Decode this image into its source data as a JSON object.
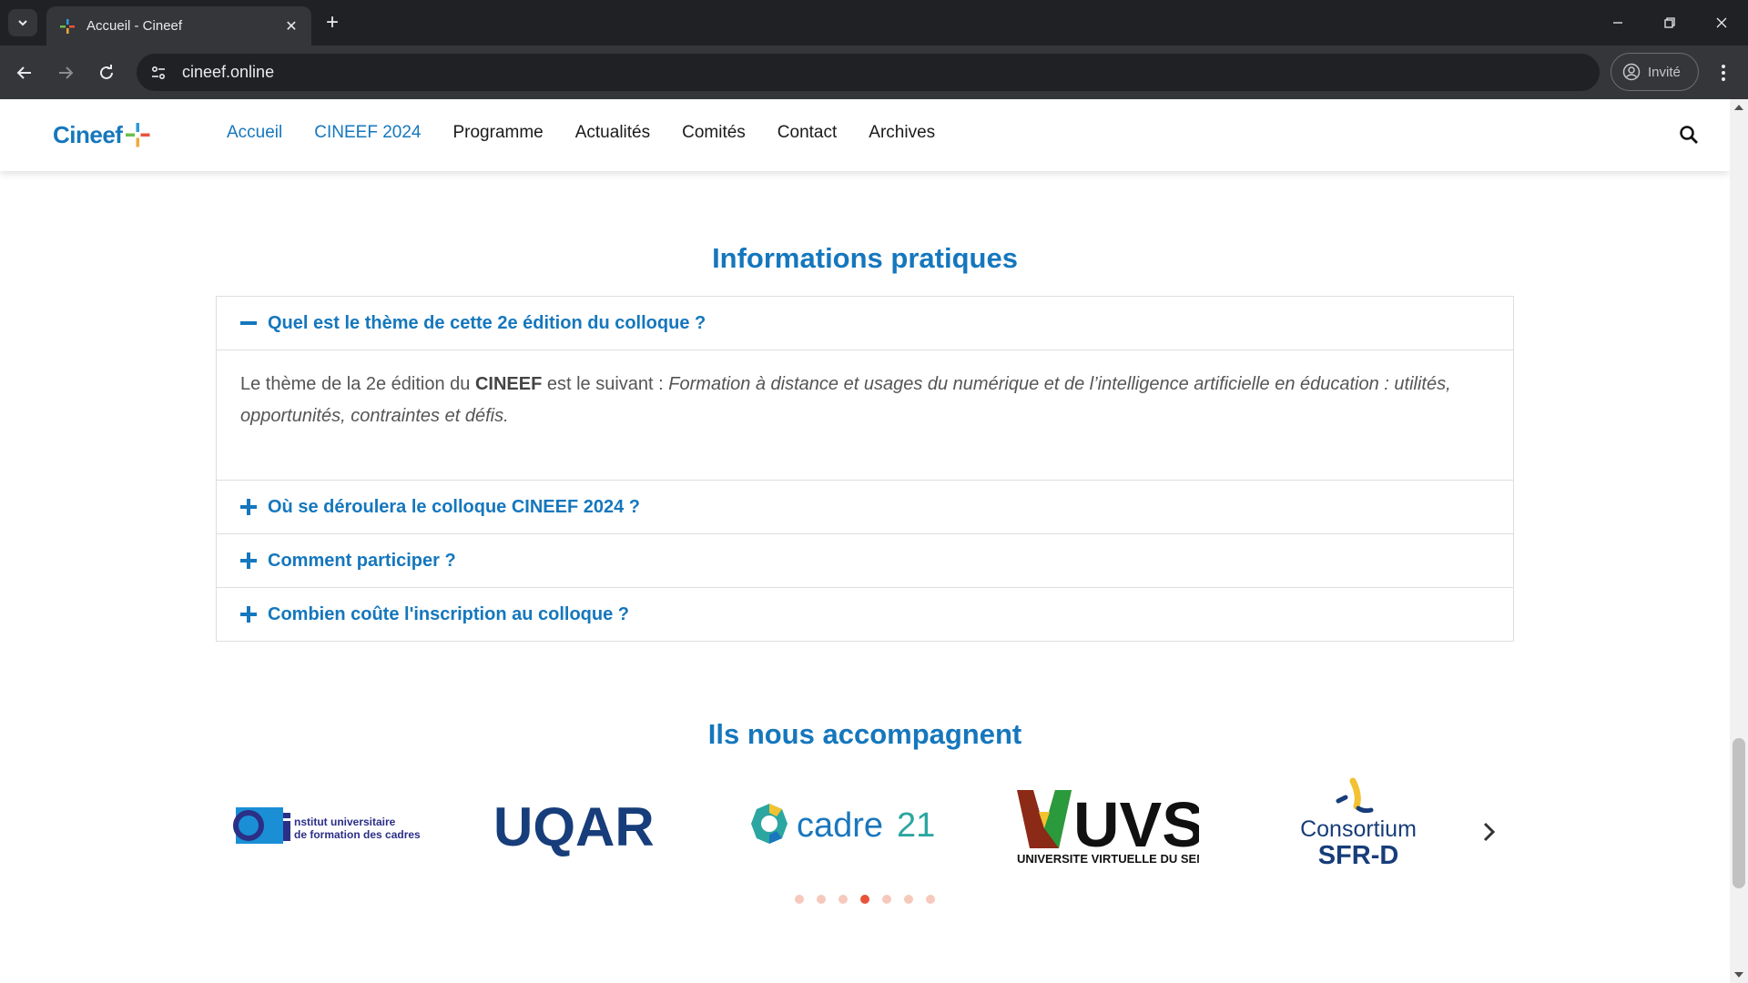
{
  "browser": {
    "tab_title": "Accueil - Cineef",
    "url": "cineef.online",
    "profile_label": "Invité"
  },
  "header": {
    "logo_text": "Cineef",
    "nav": [
      {
        "label": "Accueil",
        "active": true
      },
      {
        "label": "CINEEF 2024",
        "active": true
      },
      {
        "label": "Programme",
        "active": false
      },
      {
        "label": "Actualités",
        "active": false
      },
      {
        "label": "Comités",
        "active": false
      },
      {
        "label": "Contact",
        "active": false
      },
      {
        "label": "Archives",
        "active": false
      }
    ]
  },
  "faq": {
    "title": "Informations pratiques",
    "items": [
      {
        "question": "Quel est le thème de cette 2e édition du colloque ?",
        "expanded": true,
        "answer_prefix": "Le thème de la 2e édition du ",
        "answer_bold": "CINEEF",
        "answer_mid": " est le suivant : ",
        "answer_italic": "Formation à distance et usages du numérique et de l’intelligence artificielle en éducation : utilités, opportunités, contraintes et défis."
      },
      {
        "question": "Où se déroulera le colloque CINEEF 2024 ?",
        "expanded": false
      },
      {
        "question": "Comment participer ?",
        "expanded": false
      },
      {
        "question": "Combien coûte l'inscription au colloque ?",
        "expanded": false
      }
    ]
  },
  "partners": {
    "title": "Ils nous accompagnent",
    "logos": [
      {
        "name": "iufc-logo",
        "line1": "nstitut universitaire",
        "line2": "de formation des cadres"
      },
      {
        "name": "uqar-logo",
        "text": "UQAR"
      },
      {
        "name": "cadre21-logo",
        "text": "cadre",
        "suffix": "21"
      },
      {
        "name": "uvs-logo",
        "text": "UVS",
        "subtitle": "UNIVERSITE VIRTUELLE DU SENEGAL"
      },
      {
        "name": "consortium-sfrd-logo",
        "line1": "Consortium",
        "line2": "SFR-D"
      }
    ],
    "dots_total": 7,
    "dots_active_index": 3
  },
  "colors": {
    "brand_blue": "#1577bd",
    "accent_orange": "#e8543a",
    "chrome_dark": "#202124",
    "chrome_mid": "#35363a"
  }
}
